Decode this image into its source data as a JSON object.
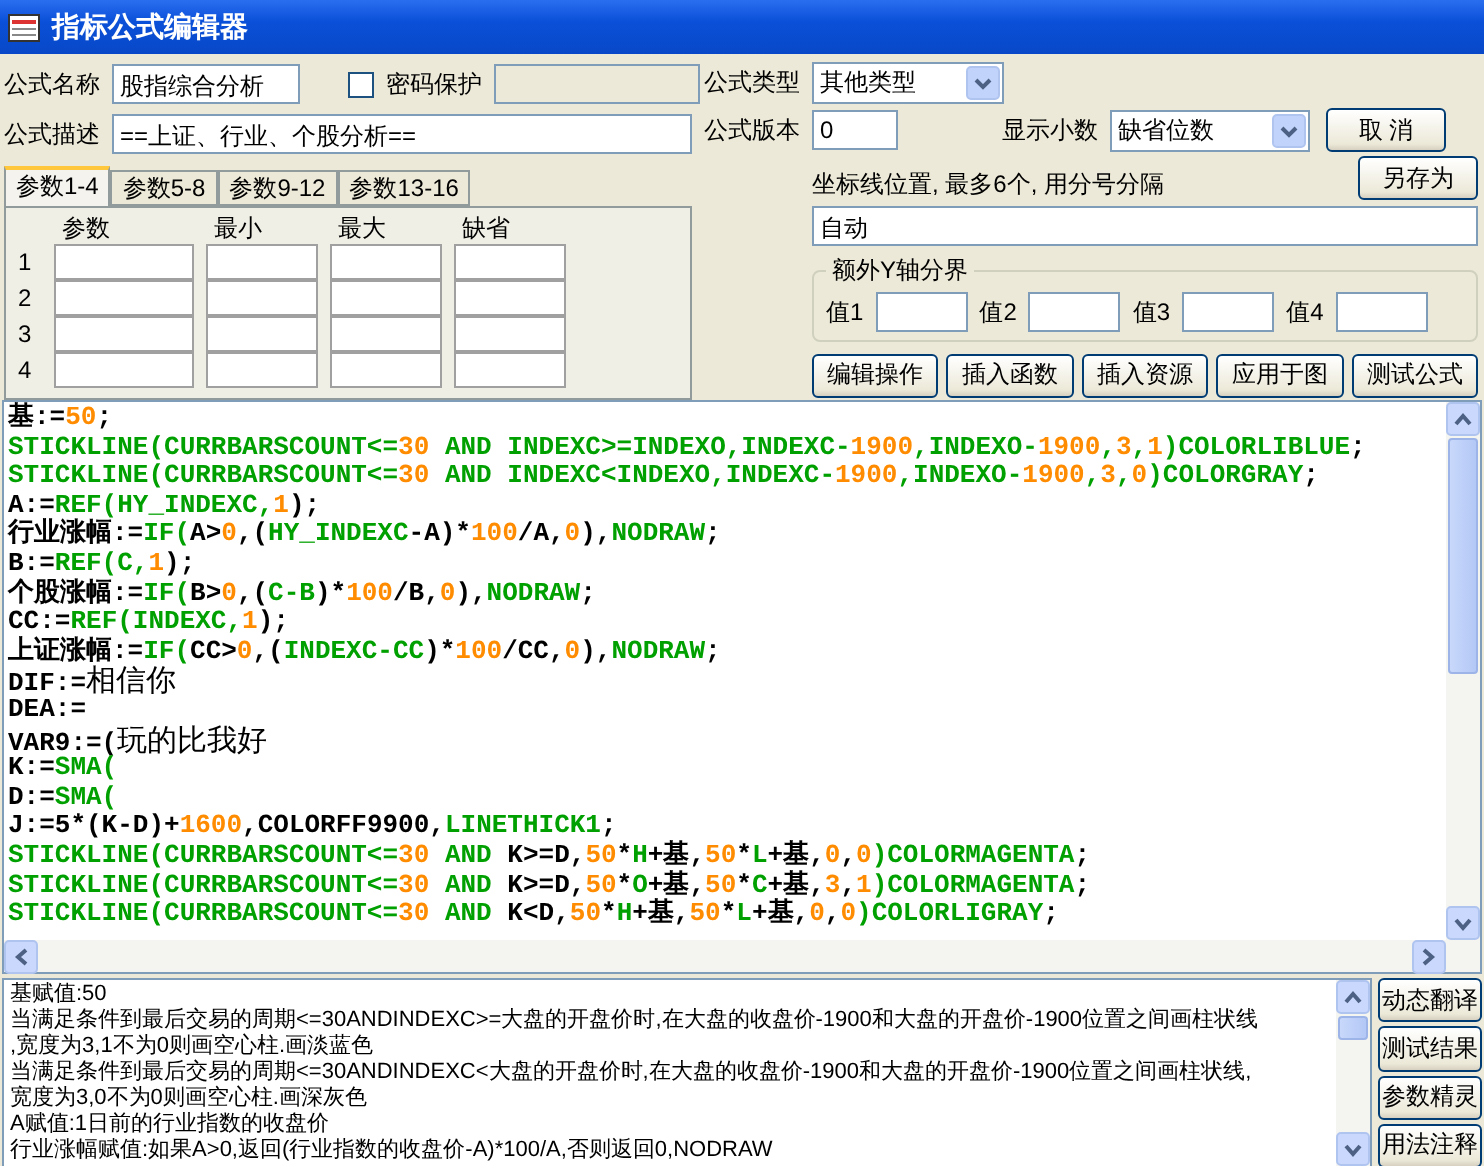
{
  "window": {
    "title": "指标公式编辑器"
  },
  "formula_name": {
    "label": "公式名称",
    "value": "股指综合分析"
  },
  "password": {
    "label": "密码保护",
    "checked": false
  },
  "formula_type": {
    "label": "公式类型",
    "value": "其他类型"
  },
  "description": {
    "label": "公式描述",
    "value": "==上证、行业、个股分析=="
  },
  "version": {
    "label": "公式版本",
    "value": "0"
  },
  "decimals": {
    "label": "显示小数",
    "value": "缺省位数"
  },
  "cancel_button": "取  消",
  "param_tabs": [
    {
      "label": "参数1-4",
      "selected": true
    },
    {
      "label": "参数5-8",
      "selected": false
    },
    {
      "label": "参数9-12",
      "selected": false
    },
    {
      "label": "参数13-16",
      "selected": false
    }
  ],
  "param_table": {
    "columns": [
      "参数",
      "最小",
      "最大",
      "缺省"
    ],
    "rows": [
      "1",
      "2",
      "3",
      "4"
    ]
  },
  "axis_lines": {
    "label": "坐标线位置, 最多6个, 用分号分隔",
    "value": "自动"
  },
  "save_as_button": "另存为",
  "y_axis_group": {
    "title": "额外Y轴分界",
    "fields": [
      "值1",
      "值2",
      "值3",
      "值4"
    ]
  },
  "action_buttons": [
    "编辑操作",
    "插入函数",
    "插入资源",
    "应用于图",
    "测试公式"
  ],
  "code_lines": [
    [
      {
        "kind": "plain",
        "text": "基:="
      },
      {
        "kind": "number",
        "text": "50"
      },
      {
        "kind": "plain",
        "text": ";"
      }
    ],
    [
      {
        "kind": "func",
        "text": "STICKLINE(CURRBARSCOUNT<="
      },
      {
        "kind": "number",
        "text": "30"
      },
      {
        "kind": "func",
        "text": " AND INDEXC>=INDEXO,INDEXC-"
      },
      {
        "kind": "number",
        "text": "1900"
      },
      {
        "kind": "func",
        "text": ",INDEXO-"
      },
      {
        "kind": "number",
        "text": "1900"
      },
      {
        "kind": "func",
        "text": ","
      },
      {
        "kind": "number",
        "text": "3"
      },
      {
        "kind": "func",
        "text": ","
      },
      {
        "kind": "number",
        "text": "1"
      },
      {
        "kind": "func",
        "text": ")COLORLIBLUE"
      },
      {
        "kind": "plain",
        "text": ";"
      }
    ],
    [
      {
        "kind": "func",
        "text": "STICKLINE(CURRBARSCOUNT<="
      },
      {
        "kind": "number",
        "text": "30"
      },
      {
        "kind": "func",
        "text": " AND INDEXC<INDEXO,INDEXC-"
      },
      {
        "kind": "number",
        "text": "1900"
      },
      {
        "kind": "func",
        "text": ",INDEXO-"
      },
      {
        "kind": "number",
        "text": "1900"
      },
      {
        "kind": "func",
        "text": ","
      },
      {
        "kind": "number",
        "text": "3"
      },
      {
        "kind": "func",
        "text": ","
      },
      {
        "kind": "number",
        "text": "0"
      },
      {
        "kind": "func",
        "text": ")COLORGRAY"
      },
      {
        "kind": "plain",
        "text": ";"
      }
    ],
    [
      {
        "kind": "plain",
        "text": "A:="
      },
      {
        "kind": "func",
        "text": "REF(HY_INDEXC,"
      },
      {
        "kind": "number",
        "text": "1"
      },
      {
        "kind": "plain",
        "text": ");"
      }
    ],
    [
      {
        "kind": "plain",
        "text": "行业涨幅:="
      },
      {
        "kind": "func",
        "text": "IF("
      },
      {
        "kind": "plain",
        "text": "A>"
      },
      {
        "kind": "number",
        "text": "0"
      },
      {
        "kind": "plain",
        "text": ",("
      },
      {
        "kind": "func",
        "text": "HY_INDEXC"
      },
      {
        "kind": "plain",
        "text": "-A)*"
      },
      {
        "kind": "number",
        "text": "100"
      },
      {
        "kind": "plain",
        "text": "/A,"
      },
      {
        "kind": "number",
        "text": "0"
      },
      {
        "kind": "plain",
        "text": "),"
      },
      {
        "kind": "func",
        "text": "NODRAW"
      },
      {
        "kind": "plain",
        "text": ";"
      }
    ],
    [
      {
        "kind": "plain",
        "text": "B:="
      },
      {
        "kind": "func",
        "text": "REF(C,"
      },
      {
        "kind": "number",
        "text": "1"
      },
      {
        "kind": "plain",
        "text": ");"
      }
    ],
    [
      {
        "kind": "plain",
        "text": "个股涨幅:="
      },
      {
        "kind": "func",
        "text": "IF("
      },
      {
        "kind": "plain",
        "text": "B>"
      },
      {
        "kind": "number",
        "text": "0"
      },
      {
        "kind": "plain",
        "text": ",("
      },
      {
        "kind": "func",
        "text": "C-B"
      },
      {
        "kind": "plain",
        "text": ")*"
      },
      {
        "kind": "number",
        "text": "100"
      },
      {
        "kind": "plain",
        "text": "/B,"
      },
      {
        "kind": "number",
        "text": "0"
      },
      {
        "kind": "plain",
        "text": "),"
      },
      {
        "kind": "func",
        "text": "NODRAW"
      },
      {
        "kind": "plain",
        "text": ";"
      }
    ],
    [
      {
        "kind": "plain",
        "text": "CC:="
      },
      {
        "kind": "func",
        "text": "REF(INDEXC,"
      },
      {
        "kind": "number",
        "text": "1"
      },
      {
        "kind": "plain",
        "text": ");"
      }
    ],
    [
      {
        "kind": "plain",
        "text": "上证涨幅:="
      },
      {
        "kind": "func",
        "text": "IF("
      },
      {
        "kind": "plain",
        "text": "CC>"
      },
      {
        "kind": "number",
        "text": "0"
      },
      {
        "kind": "plain",
        "text": ",("
      },
      {
        "kind": "func",
        "text": "INDEXC-CC"
      },
      {
        "kind": "plain",
        "text": ")*"
      },
      {
        "kind": "number",
        "text": "100"
      },
      {
        "kind": "plain",
        "text": "/CC,"
      },
      {
        "kind": "number",
        "text": "0"
      },
      {
        "kind": "plain",
        "text": "),"
      },
      {
        "kind": "func",
        "text": "NODRAW"
      },
      {
        "kind": "plain",
        "text": ";"
      }
    ],
    [
      {
        "kind": "plain",
        "text": "DIF:="
      },
      {
        "kind": "overlay",
        "text": "相信你"
      }
    ],
    [
      {
        "kind": "plain",
        "text": "DEA:="
      }
    ],
    [
      {
        "kind": "plain",
        "text": "VAR9:=("
      },
      {
        "kind": "overlay",
        "text": "玩的比我好"
      }
    ],
    [
      {
        "kind": "plain",
        "text": "K:="
      },
      {
        "kind": "func",
        "text": "SMA("
      }
    ],
    [
      {
        "kind": "plain",
        "text": "D:="
      },
      {
        "kind": "func",
        "text": "SMA("
      }
    ],
    [
      {
        "kind": "plain",
        "text": "J:=5*(K-D)+"
      },
      {
        "kind": "number",
        "text": "1600"
      },
      {
        "kind": "plain",
        "text": ",COLORFF9900,"
      },
      {
        "kind": "func",
        "text": "LINETHICK1"
      },
      {
        "kind": "plain",
        "text": ";"
      }
    ],
    [
      {
        "kind": "func",
        "text": "STICKLINE(CURRBARSCOUNT<="
      },
      {
        "kind": "number",
        "text": "30"
      },
      {
        "kind": "func",
        "text": " AND "
      },
      {
        "kind": "plain",
        "text": "K>=D,"
      },
      {
        "kind": "number",
        "text": "50"
      },
      {
        "kind": "plain",
        "text": "*"
      },
      {
        "kind": "func",
        "text": "H"
      },
      {
        "kind": "plain",
        "text": "+基,"
      },
      {
        "kind": "number",
        "text": "50"
      },
      {
        "kind": "plain",
        "text": "*"
      },
      {
        "kind": "func",
        "text": "L"
      },
      {
        "kind": "plain",
        "text": "+基,"
      },
      {
        "kind": "number",
        "text": "0"
      },
      {
        "kind": "plain",
        "text": ","
      },
      {
        "kind": "number",
        "text": "0"
      },
      {
        "kind": "func",
        "text": ")COLORMAGENTA"
      },
      {
        "kind": "plain",
        "text": ";"
      }
    ],
    [
      {
        "kind": "func",
        "text": "STICKLINE(CURRBARSCOUNT<="
      },
      {
        "kind": "number",
        "text": "30"
      },
      {
        "kind": "func",
        "text": " AND "
      },
      {
        "kind": "plain",
        "text": "K>=D,"
      },
      {
        "kind": "number",
        "text": "50"
      },
      {
        "kind": "plain",
        "text": "*"
      },
      {
        "kind": "func",
        "text": "O"
      },
      {
        "kind": "plain",
        "text": "+基,"
      },
      {
        "kind": "number",
        "text": "50"
      },
      {
        "kind": "plain",
        "text": "*"
      },
      {
        "kind": "func",
        "text": "C"
      },
      {
        "kind": "plain",
        "text": "+基,"
      },
      {
        "kind": "number",
        "text": "3"
      },
      {
        "kind": "plain",
        "text": ","
      },
      {
        "kind": "number",
        "text": "1"
      },
      {
        "kind": "func",
        "text": ")COLORMAGENTA"
      },
      {
        "kind": "plain",
        "text": ";"
      }
    ],
    [
      {
        "kind": "func",
        "text": "STICKLINE(CURRBARSCOUNT<="
      },
      {
        "kind": "number",
        "text": "30"
      },
      {
        "kind": "func",
        "text": " AND "
      },
      {
        "kind": "plain",
        "text": "K<D,"
      },
      {
        "kind": "number",
        "text": "50"
      },
      {
        "kind": "plain",
        "text": "*"
      },
      {
        "kind": "func",
        "text": "H"
      },
      {
        "kind": "plain",
        "text": "+基,"
      },
      {
        "kind": "number",
        "text": "50"
      },
      {
        "kind": "plain",
        "text": "*"
      },
      {
        "kind": "func",
        "text": "L"
      },
      {
        "kind": "plain",
        "text": "+基,"
      },
      {
        "kind": "number",
        "text": "0"
      },
      {
        "kind": "plain",
        "text": ","
      },
      {
        "kind": "number",
        "text": "0"
      },
      {
        "kind": "func",
        "text": ")COLORLIGRAY"
      },
      {
        "kind": "plain",
        "text": ";"
      }
    ]
  ],
  "translation_lines": [
    "基赋值:50",
    "当满足条件到最后交易的周期<=30ANDINDEXC>=大盘的开盘价时,在大盘的收盘价-1900和大盘的开盘价-1900位置之间画柱状线",
    ",宽度为3,1不为0则画空心柱.画淡蓝色",
    "当满足条件到最后交易的周期<=30ANDINDEXC<大盘的开盘价时,在大盘的收盘价-1900和大盘的开盘价-1900位置之间画柱状线,",
    "宽度为3,0不为0则画空心柱.画深灰色",
    "A赋值:1日前的行业指数的收盘价",
    "行业涨幅赋值:如果A>0,返回(行业指数的收盘价-A)*100/A,否则返回0,NODRAW"
  ],
  "side_buttons": [
    "动态翻译",
    "测试结果",
    "参数精灵",
    "用法注释"
  ]
}
